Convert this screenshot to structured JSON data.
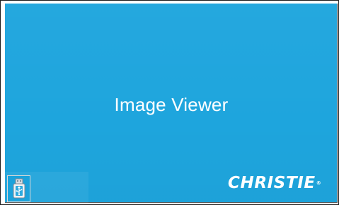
{
  "screen": {
    "title": "Image Viewer",
    "brand_logo_text": "CHRISTIE",
    "brand_trademark": "®",
    "background_color": "#1ea5dd"
  },
  "taskbar": {
    "usb_button": {
      "icon": "usb-drive-icon"
    }
  }
}
